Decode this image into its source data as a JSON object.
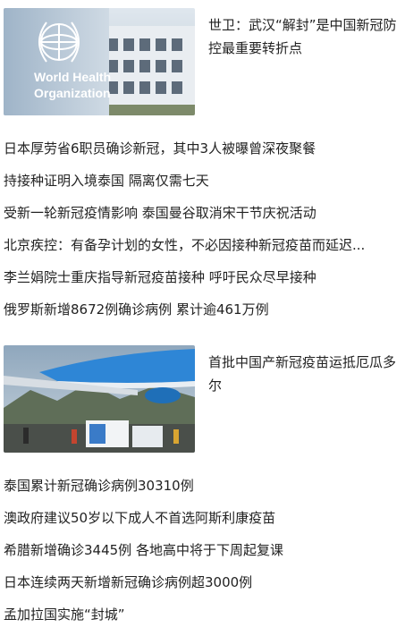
{
  "featured": [
    {
      "title": "世卫：武汉“解封”是中国新冠防控最重要转折点",
      "image_logo_text_1": "World Health",
      "image_logo_text_2": "Organization"
    },
    {
      "title": "首批中国产新冠疫苗运抵厄瓜多尔"
    }
  ],
  "list1": [
    "日本厚劳省6职员确诊新冠，其中3人被曝曾深夜聚餐",
    "持接种证明入境泰国 隔离仅需七天",
    "受新一轮新冠疫情影响 泰国曼谷取消宋干节庆祝活动",
    "北京疾控：有备孕计划的女性，不必因接种新冠疫苗而延迟...",
    "李兰娟院士重庆指导新冠疫苗接种 呼吁民众尽早接种",
    "俄罗斯新增8672例确诊病例 累计逾461万例"
  ],
  "list2": [
    "泰国累计新冠确诊病例30310例",
    "澳政府建议50岁以下成人不首选阿斯利康疫苗",
    "希腊新增确诊3445例 各地高中将于下周起复课",
    "日本连续两天新增新冠确诊病例超3000例",
    "孟加拉国实施“封城”"
  ]
}
